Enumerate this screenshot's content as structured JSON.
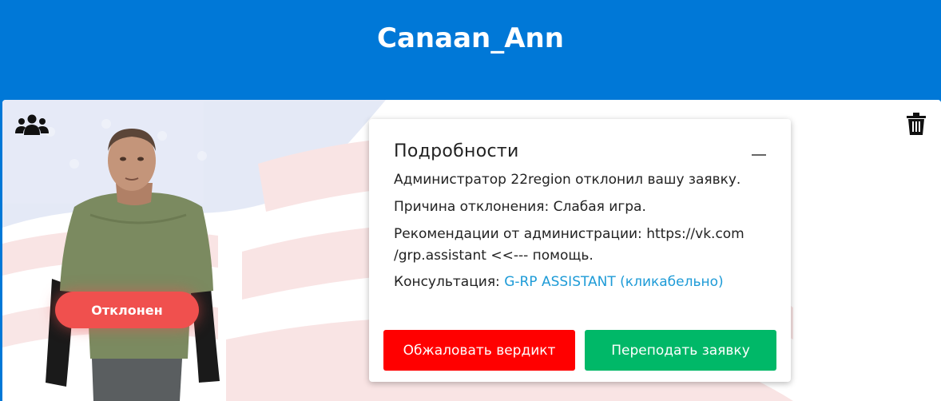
{
  "header": {
    "title": "Canaan_Ann"
  },
  "icons": {
    "group": "users-icon",
    "delete": "trash-icon",
    "collapse": "minus-icon"
  },
  "status": {
    "label": "Отклонен",
    "color": "#f0504e"
  },
  "details": {
    "title": "Подробности",
    "line1": "Администратор 22region отклонил вашу заявку.",
    "line2": "Причина отклонения: Слабая игра.",
    "line3a": "Рекомендации от администрации: https://vk.com",
    "line3b": "/grp.assistant <<--- помощь.",
    "consult_label": "Консультация: ",
    "consult_link": "G-RP ASSISTANT (кликабельно)"
  },
  "buttons": {
    "appeal": "Обжаловать вердикт",
    "resubmit": "Переподать заявку"
  },
  "colors": {
    "header": "#0078d7",
    "appeal": "#ff0000",
    "resubmit": "#00b868",
    "link": "#1e9bd7"
  }
}
